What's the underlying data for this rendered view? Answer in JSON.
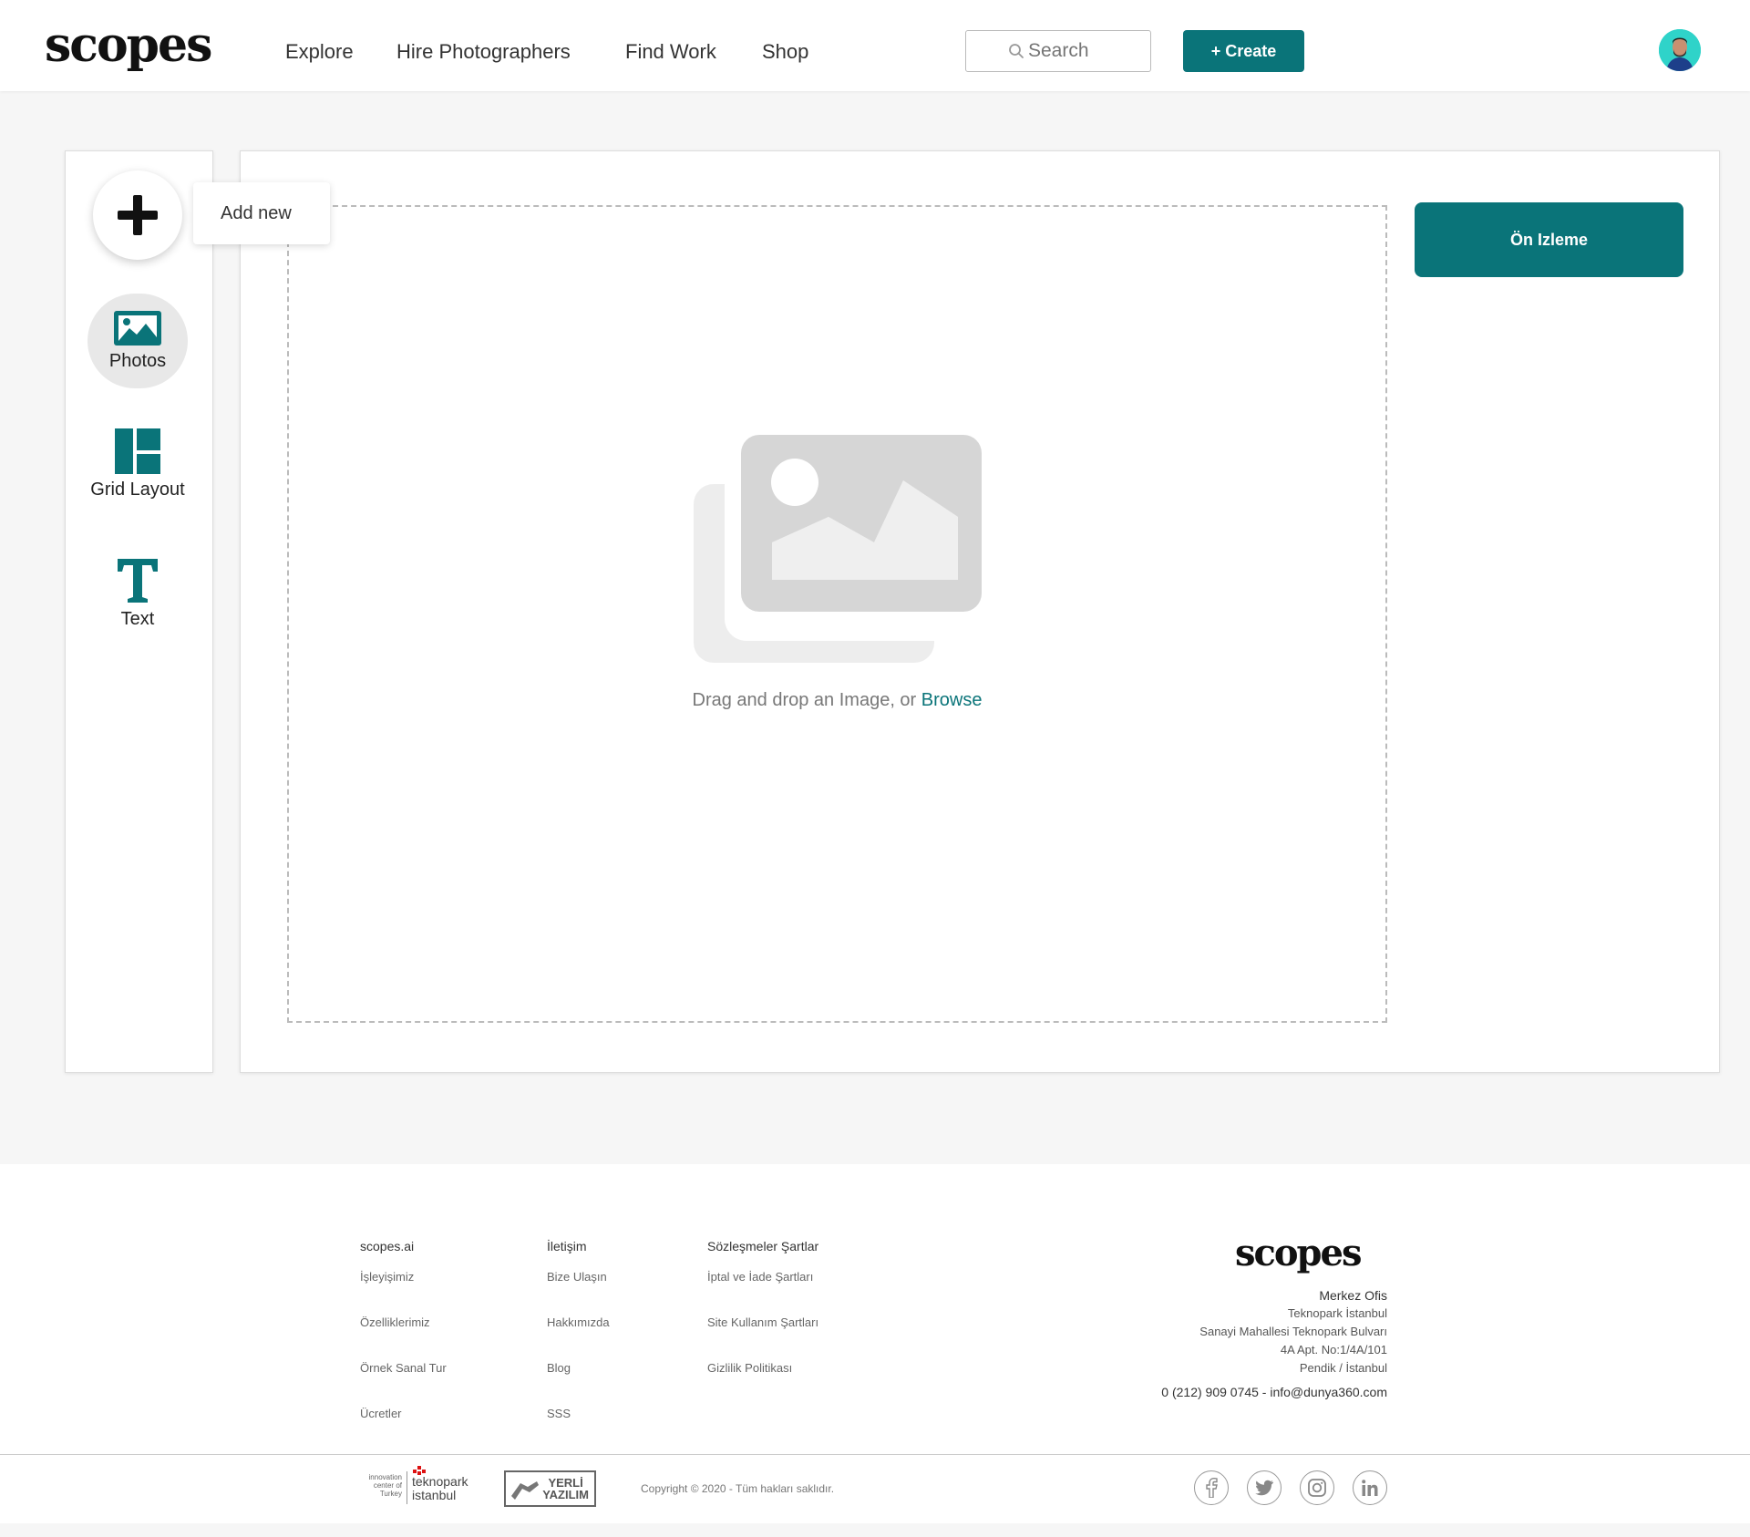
{
  "header": {
    "logo": "scopes",
    "nav": [
      "Explore",
      "Hire Photographers",
      "Find Work",
      "Shop"
    ],
    "search_placeholder": "Search",
    "create_label": "+ Create"
  },
  "sidebar": {
    "add_new_label": "Add new",
    "tools": [
      "Photos",
      "Grid Layout",
      "Text"
    ]
  },
  "canvas": {
    "drop_text": "Drag and drop an Image, or",
    "browse_label": "Browse",
    "preview_label": "Ön Izleme"
  },
  "footer": {
    "columns": [
      {
        "heading": "scopes.ai",
        "links": [
          "İşleyişimiz",
          "Özelliklerimiz",
          "Örnek Sanal Tur",
          "Ücretler"
        ]
      },
      {
        "heading": "İletişim",
        "links": [
          "Bize Ulaşın",
          "Hakkımızda",
          "Blog",
          "SSS"
        ]
      },
      {
        "heading": "Sözleşmeler Şartlar",
        "links": [
          "İptal ve İade Şartları",
          "Site Kullanım Şartları",
          "Gizlilik Politikası"
        ]
      }
    ],
    "logo": "scopes",
    "office": {
      "title": "Merkez Ofis",
      "lines": [
        "Teknopark İstanbul",
        "Sanayi Mahallesi Teknopark Bulvarı",
        "4A Apt. No:1/4A/101",
        "Pendik / İstanbul"
      ]
    },
    "contact": "0 (212) 909 0745 - info@dunya360.com",
    "copyright": "Copyright © 2020 - Tüm hakları saklıdır.",
    "badges": {
      "teknopark_small": [
        "innovation",
        "center of",
        "Turkey"
      ],
      "teknopark_big": [
        "teknopark",
        "istanbul"
      ],
      "yerli": [
        "YERLİ",
        "YAZILIM"
      ]
    },
    "social": [
      "facebook-icon",
      "twitter-icon",
      "instagram-icon",
      "linkedin-icon"
    ]
  },
  "colors": {
    "accent": "#0a7479",
    "background": "#f6f6f6"
  }
}
